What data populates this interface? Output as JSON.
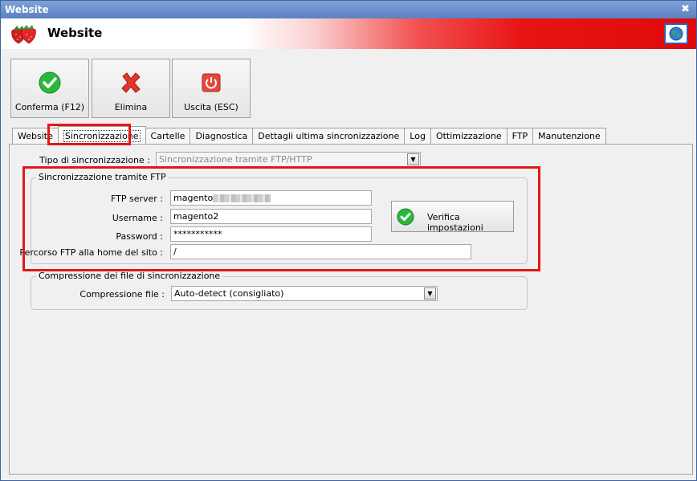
{
  "window": {
    "title": "Website",
    "header_title": "Website"
  },
  "toolbar": {
    "confirm_label": "Conferma (F12)",
    "delete_label": "Elimina",
    "exit_label": "Uscita (ESC)"
  },
  "tabs": [
    {
      "label": "Website"
    },
    {
      "label": "Sincronizzazione"
    },
    {
      "label": "Cartelle"
    },
    {
      "label": "Diagnostica"
    },
    {
      "label": "Dettagli ultima sincronizzazione"
    },
    {
      "label": "Log"
    },
    {
      "label": "Ottimizzazione"
    },
    {
      "label": "FTP"
    },
    {
      "label": "Manutenzione"
    }
  ],
  "sync": {
    "type_label": "Tipo di sincronizzazione :",
    "type_value": "Sincronizzazione tramite FTP/HTTP"
  },
  "ftp_group": {
    "legend": "Sincronizzazione tramite FTP",
    "server_label": "FTP server :",
    "server_value": "magento",
    "username_label": "Username :",
    "username_value": "magento2",
    "password_label": "Password :",
    "password_value": "***********",
    "path_label": "Percorso FTP alla home del sito :",
    "path_value": "/",
    "verify_label": "Verifica impostazioni"
  },
  "compression_group": {
    "legend": "Compressione dei file di sincronizzazione",
    "label": "Compressione file :",
    "value": "Auto-detect (consigliato)"
  },
  "colors": {
    "accent_red": "#e01818",
    "title_blue": "#5a82c2",
    "ok_green": "#2db83d"
  }
}
